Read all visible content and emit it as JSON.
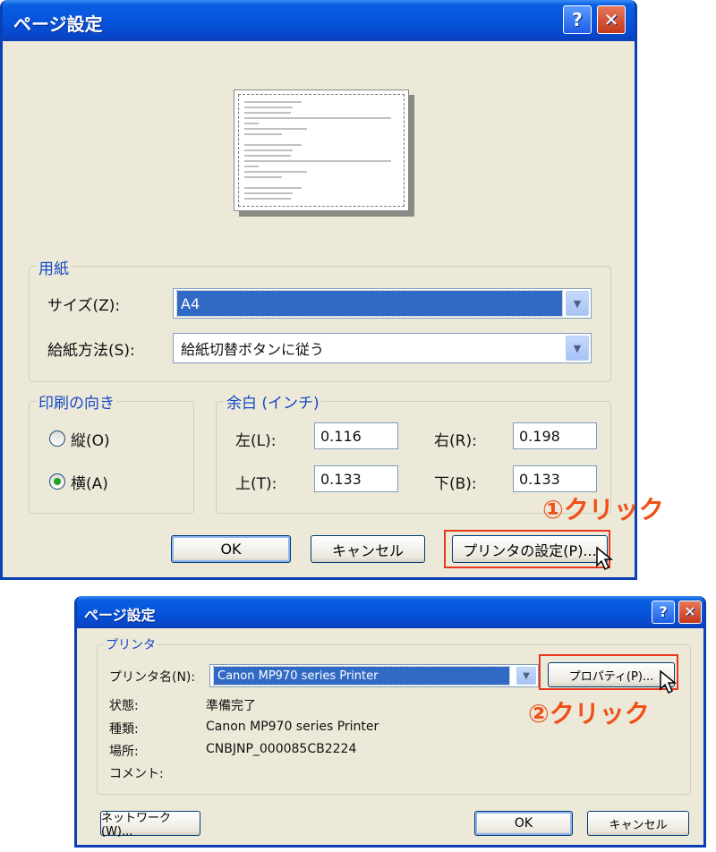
{
  "dialog1": {
    "title": "ページ設定",
    "help_label": "?",
    "paper_group": {
      "label": "用紙",
      "size_label": "サイズ(Z):",
      "size_value": "A4",
      "source_label": "給紙方法(S):",
      "source_value": "給紙切替ボタンに従う"
    },
    "orientation_group": {
      "label": "印刷の向き",
      "portrait_label": "縦(O)",
      "landscape_label": "横(A)",
      "selected": "landscape"
    },
    "margin_group": {
      "label": "余白 (インチ)",
      "left_label": "左(L):",
      "left_value": "0.116",
      "right_label": "右(R):",
      "right_value": "0.198",
      "top_label": "上(T):",
      "top_value": "0.133",
      "bottom_label": "下(B):",
      "bottom_value": "0.133"
    },
    "ok_label": "OK",
    "cancel_label": "キャンセル",
    "printer_button_label": "プリンタの設定(P)..."
  },
  "annotation1": "①クリック",
  "dialog2": {
    "title": "ページ設定",
    "help_label": "?",
    "printer_group": {
      "label": "プリンタ",
      "name_label": "プリンタ名(N):",
      "name_value": "Canon MP970 series Printer",
      "properties_label": "プロパティ(P)...",
      "status_label": "状態:",
      "status_value": "準備完了",
      "type_label": "種類:",
      "type_value": "Canon MP970 series Printer",
      "location_label": "場所:",
      "location_value": "CNBJNP_000085CB2224",
      "comment_label": "コメント:",
      "comment_value": ""
    },
    "network_label": "ネットワーク(W)...",
    "ok_label": "OK",
    "cancel_label": "キャンセル"
  },
  "annotation2": "②クリック",
  "colors": {
    "titlebar": "#0653dc",
    "dialog_bg": "#ece9d8",
    "group_label": "#1549c4",
    "selection": "#316ac5",
    "annotation": "#f05018"
  }
}
